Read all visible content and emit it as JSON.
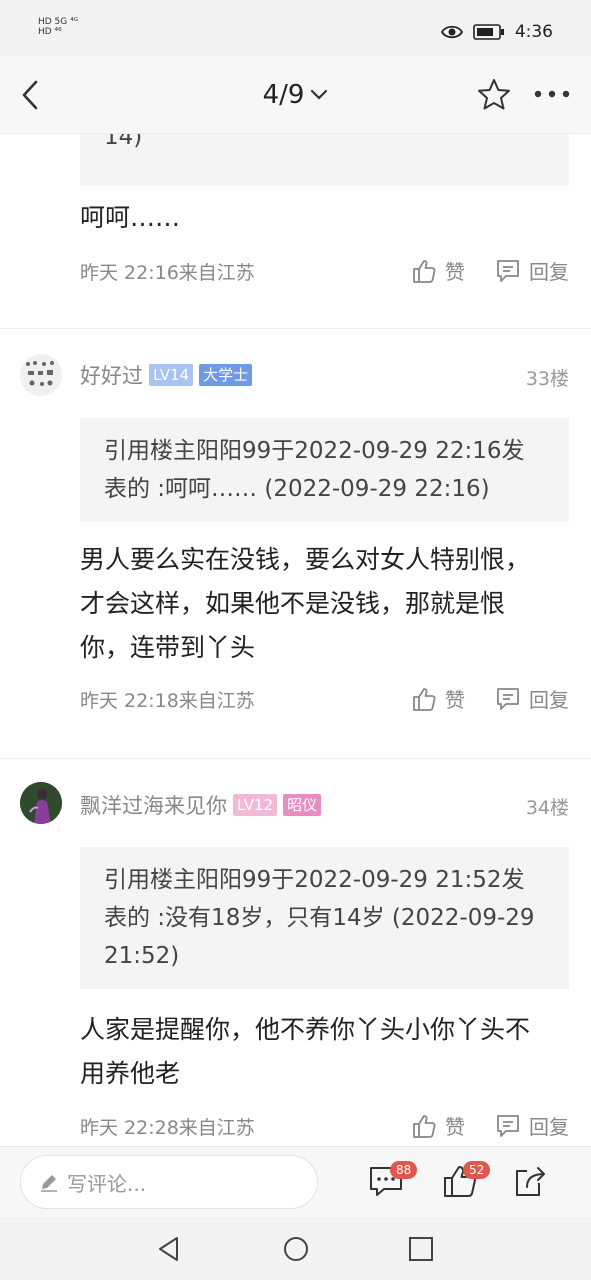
{
  "status_bar": {
    "left_line1": "HD 5G ⁴ᴳ",
    "left_line2": "HD ⁴⁶",
    "time": "4:36"
  },
  "nav": {
    "page_indicator": "4/9",
    "icons": [
      "back-icon",
      "chevron-down-icon",
      "star-icon",
      "more-icon"
    ]
  },
  "posts": [
    {
      "quote_tail": "14)",
      "text": "呵呵……",
      "meta": "昨天 22:16来自江苏",
      "like_label": "赞",
      "reply_label": "回复"
    },
    {
      "username": "好好过",
      "level": "LV14",
      "title_badge": "大学士",
      "floor": "33楼",
      "quote": "引用楼主阳阳99于2022-09-29 22:16发表的 :呵呵…… (2022-09-29 22:16)",
      "text": "男人要么实在没钱，要么对女人特别恨，才会这样，如果他不是没钱，那就是恨你，连带到丫头",
      "meta": "昨天 22:18来自江苏",
      "like_label": "赞",
      "reply_label": "回复",
      "level_color": "#a9c4f2",
      "title_color": "#6f9ae6"
    },
    {
      "username": "飘洋过海来见你",
      "level": "LV12",
      "title_badge": "昭仪",
      "floor": "34楼",
      "quote": "引用楼主阳阳99于2022-09-29 21:52发表的 :没有18岁，只有14岁 (2022-09-29 21:52)",
      "text": "人家是提醒你，他不养你丫头小你丫头不用养他老",
      "meta": "昨天 22:28来自江苏",
      "like_label": "赞",
      "reply_label": "回复",
      "level_color": "#f2b8d8",
      "title_color": "#e88cc4"
    }
  ],
  "bottom_bar": {
    "comment_placeholder": "写评论...",
    "comment_count": "88",
    "like_count": "52"
  },
  "colors": {
    "badge_red": "#e0574d",
    "quote_bg": "#f4f4f4",
    "meta_gray": "#888888"
  }
}
